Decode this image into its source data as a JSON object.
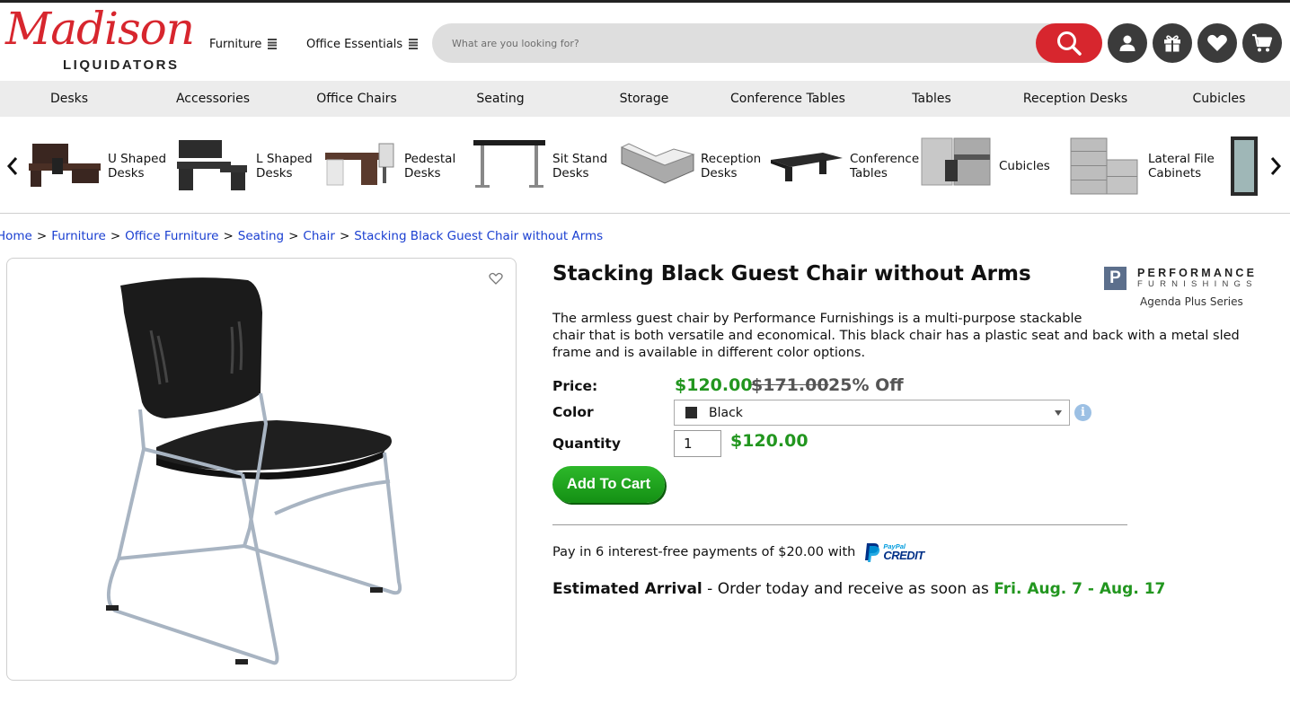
{
  "brand": {
    "logo_script": "Madison",
    "logo_sub": "LIQUIDATORS"
  },
  "topnav": [
    {
      "label": "Furniture"
    },
    {
      "label": "Office Essentials"
    }
  ],
  "search": {
    "placeholder": "What are you looking for?",
    "value": ""
  },
  "header_icons": [
    "search-icon",
    "account-icon",
    "gift-icon",
    "heart-icon",
    "cart-icon"
  ],
  "categories": [
    "Desks",
    "Accessories",
    "Office Chairs",
    "Seating",
    "Storage",
    "Conference Tables",
    "Tables",
    "Reception Desks",
    "Cubicles"
  ],
  "carousel": {
    "items": [
      {
        "label": "U Shaped Desks"
      },
      {
        "label": "L Shaped Desks"
      },
      {
        "label": "Pedestal Desks"
      },
      {
        "label": "Sit Stand Desks"
      },
      {
        "label": "Reception Desks"
      },
      {
        "label": "Conference Tables"
      },
      {
        "label": "Cubicles"
      },
      {
        "label": "Lateral File Cabinets"
      }
    ]
  },
  "breadcrumb": [
    "Home",
    "Furniture",
    "Office Furniture",
    "Seating",
    "Chair",
    "Stacking Black Guest Chair without Arms"
  ],
  "product": {
    "title": "Stacking Black Guest Chair without Arms",
    "description_lines": [
      "The armless guest chair by Performance Furnishings is a multi-purpose stackable",
      "chair that is both versatile and economical. This black chair has a plastic seat and back with a metal sled",
      "frame and is available in different color options."
    ],
    "manufacturer": {
      "mark": "P",
      "name": "PERFORMANCE",
      "sub": "FURNISHINGS",
      "series": "Agenda Plus Series"
    },
    "labels": {
      "price": "Price:",
      "color": "Color",
      "quantity": "Quantity"
    },
    "price": "$120.00",
    "was_price": "$171.00",
    "discount": "25% Off",
    "color": {
      "value": "Black",
      "swatch": "#2a2a2a"
    },
    "quantity": "1",
    "line_total": "$120.00",
    "add_to_cart": "Add To Cart",
    "paypal": {
      "text": "Pay in 6 interest-free payments of $20.00 with",
      "logo_small": "PayPal",
      "logo_big": "CREDIT"
    },
    "arrival": {
      "label": "Estimated Arrival",
      "text": " - Order today and receive as soon as ",
      "date": "Fri. Aug. 7 - Aug. 17"
    }
  },
  "colors": {
    "brand_red": "#d7262e",
    "price_green": "#22961f",
    "link_blue": "#1a3fd1",
    "icon_dark": "#3b3b3b"
  }
}
